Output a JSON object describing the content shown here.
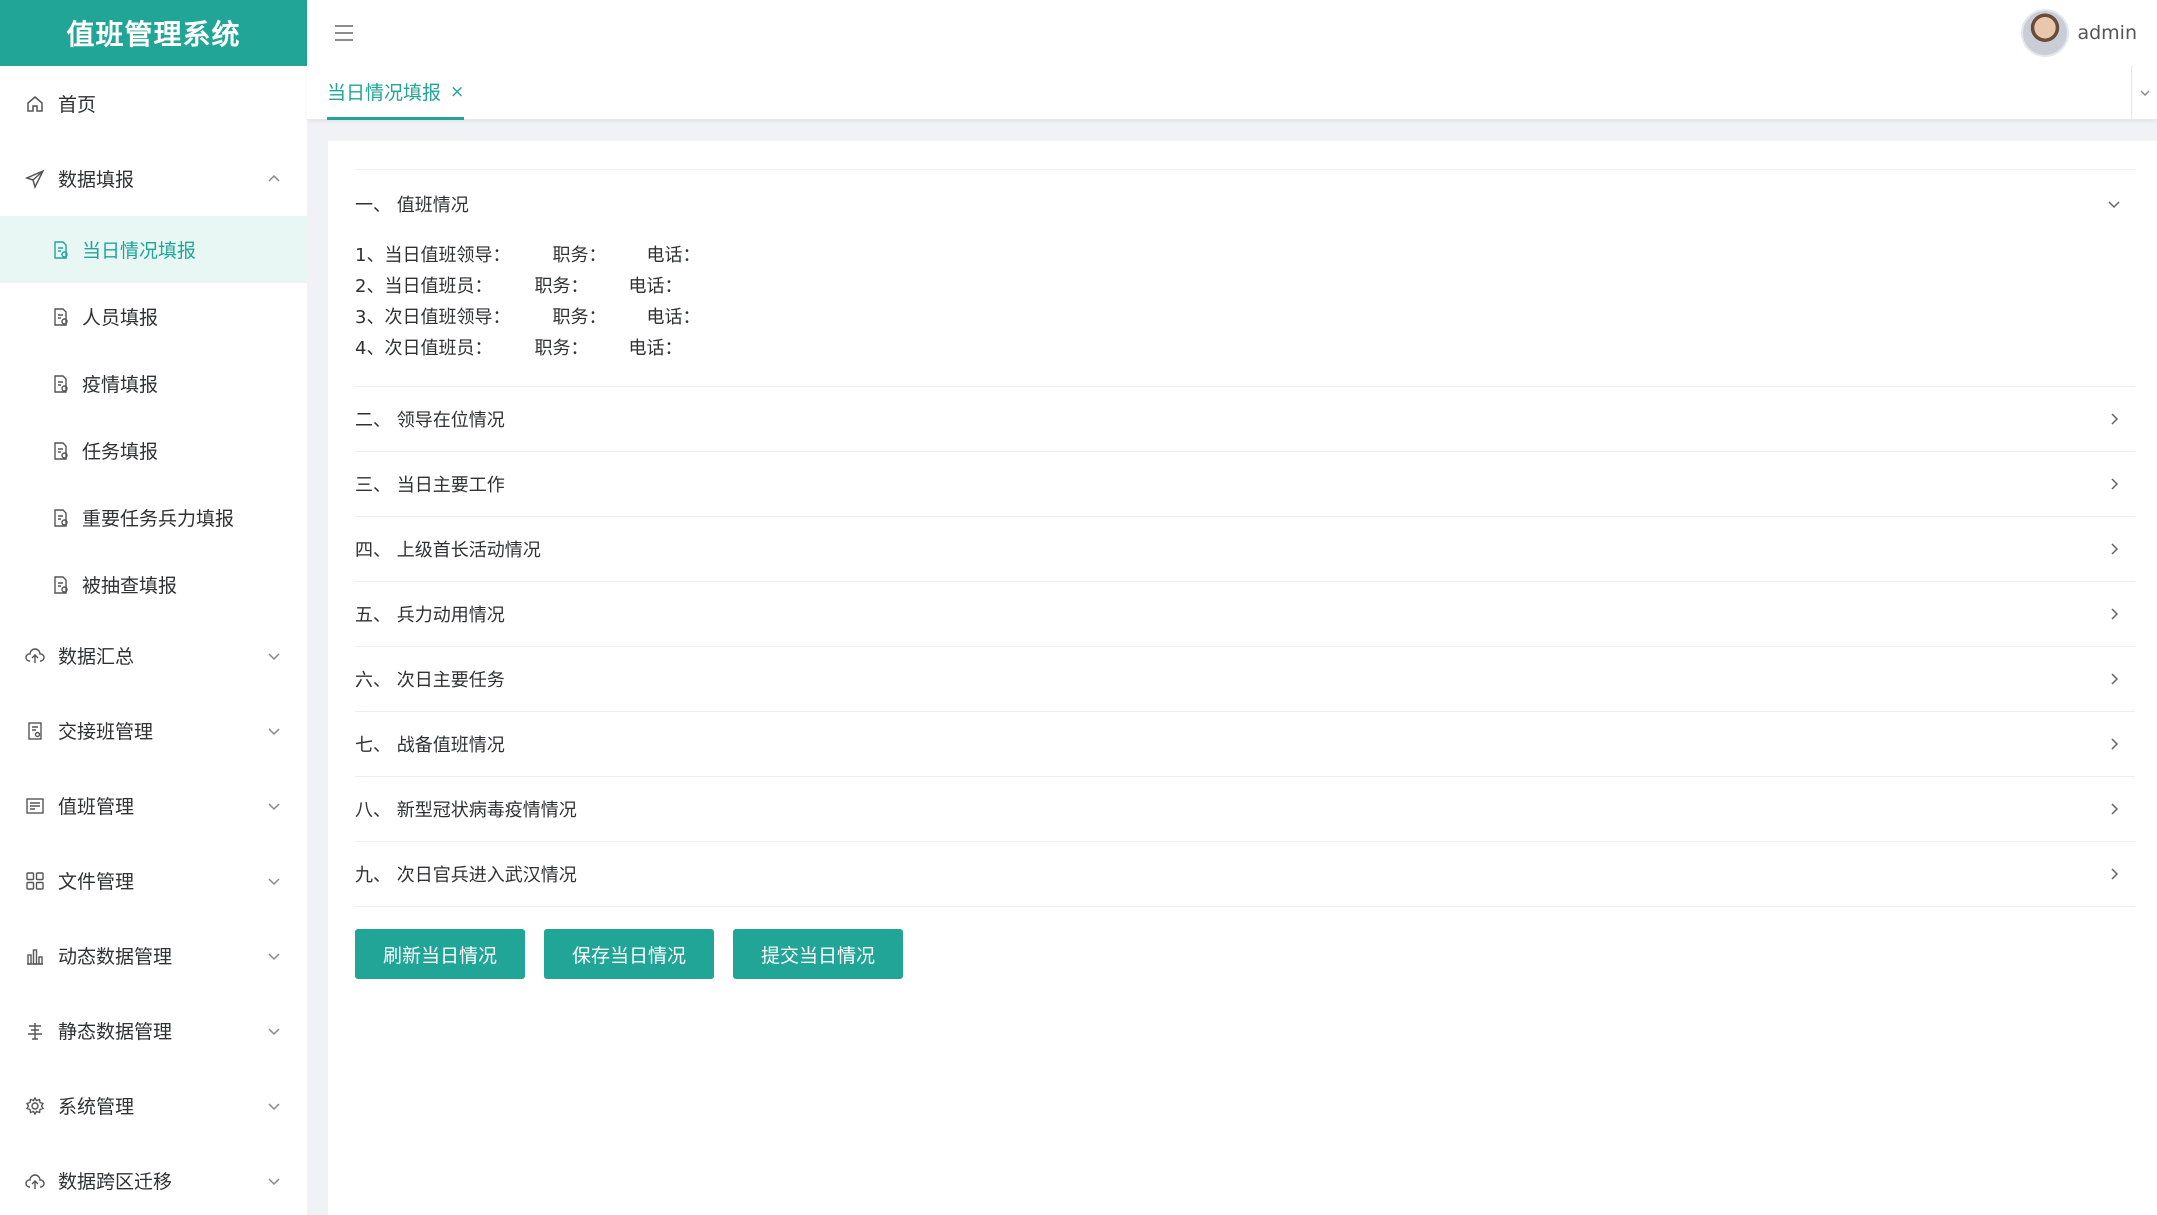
{
  "app": {
    "title": "值班管理系统",
    "brand_color": "#20a597"
  },
  "header": {
    "menu_icon": "hamburger-icon",
    "username": "admin"
  },
  "sidebar": {
    "items": [
      {
        "label": "首页",
        "icon": "home-icon"
      },
      {
        "label": "数据填报",
        "icon": "send-icon",
        "expanded": true,
        "children": [
          {
            "label": "当日情况填报",
            "active": true
          },
          {
            "label": "人员填报"
          },
          {
            "label": "疫情填报"
          },
          {
            "label": "任务填报"
          },
          {
            "label": "重要任务兵力填报"
          },
          {
            "label": "被抽查填报"
          }
        ]
      },
      {
        "label": "数据汇总",
        "icon": "cloud-upload-icon"
      },
      {
        "label": "交接班管理",
        "icon": "document-icon"
      },
      {
        "label": "值班管理",
        "icon": "list-box-icon"
      },
      {
        "label": "文件管理",
        "icon": "grid-icon"
      },
      {
        "label": "动态数据管理",
        "icon": "bar-chart-icon"
      },
      {
        "label": "静态数据管理",
        "icon": "data-icon"
      },
      {
        "label": "系统管理",
        "icon": "gear-icon"
      },
      {
        "label": "数据跨区迁移",
        "icon": "cloud-icon"
      }
    ]
  },
  "tabs": [
    {
      "label": "当日情况填报",
      "close": "×"
    }
  ],
  "sections": [
    {
      "title": "一、  值班情况",
      "expanded": true,
      "lines": [
        {
          "label": "1、当日值班领导：",
          "duty": "职务：",
          "phone": "电话："
        },
        {
          "label": "2、当日值班员：",
          "duty": "职务：",
          "phone": "电话："
        },
        {
          "label": "3、次日值班领导：",
          "duty": "职务：",
          "phone": "电话："
        },
        {
          "label": "4、次日值班员：",
          "duty": "职务：",
          "phone": "电话："
        }
      ]
    },
    {
      "title": "二、  领导在位情况"
    },
    {
      "title": "三、  当日主要工作"
    },
    {
      "title": "四、  上级首长活动情况"
    },
    {
      "title": "五、  兵力动用情况"
    },
    {
      "title": "六、  次日主要任务"
    },
    {
      "title": "七、  战备值班情况"
    },
    {
      "title": "八、  新型冠状病毒疫情情况"
    },
    {
      "title": "九、  次日官兵进入武汉情况"
    }
  ],
  "buttons": {
    "refresh": "刷新当日情况",
    "save": "保存当日情况",
    "submit": "提交当日情况"
  }
}
